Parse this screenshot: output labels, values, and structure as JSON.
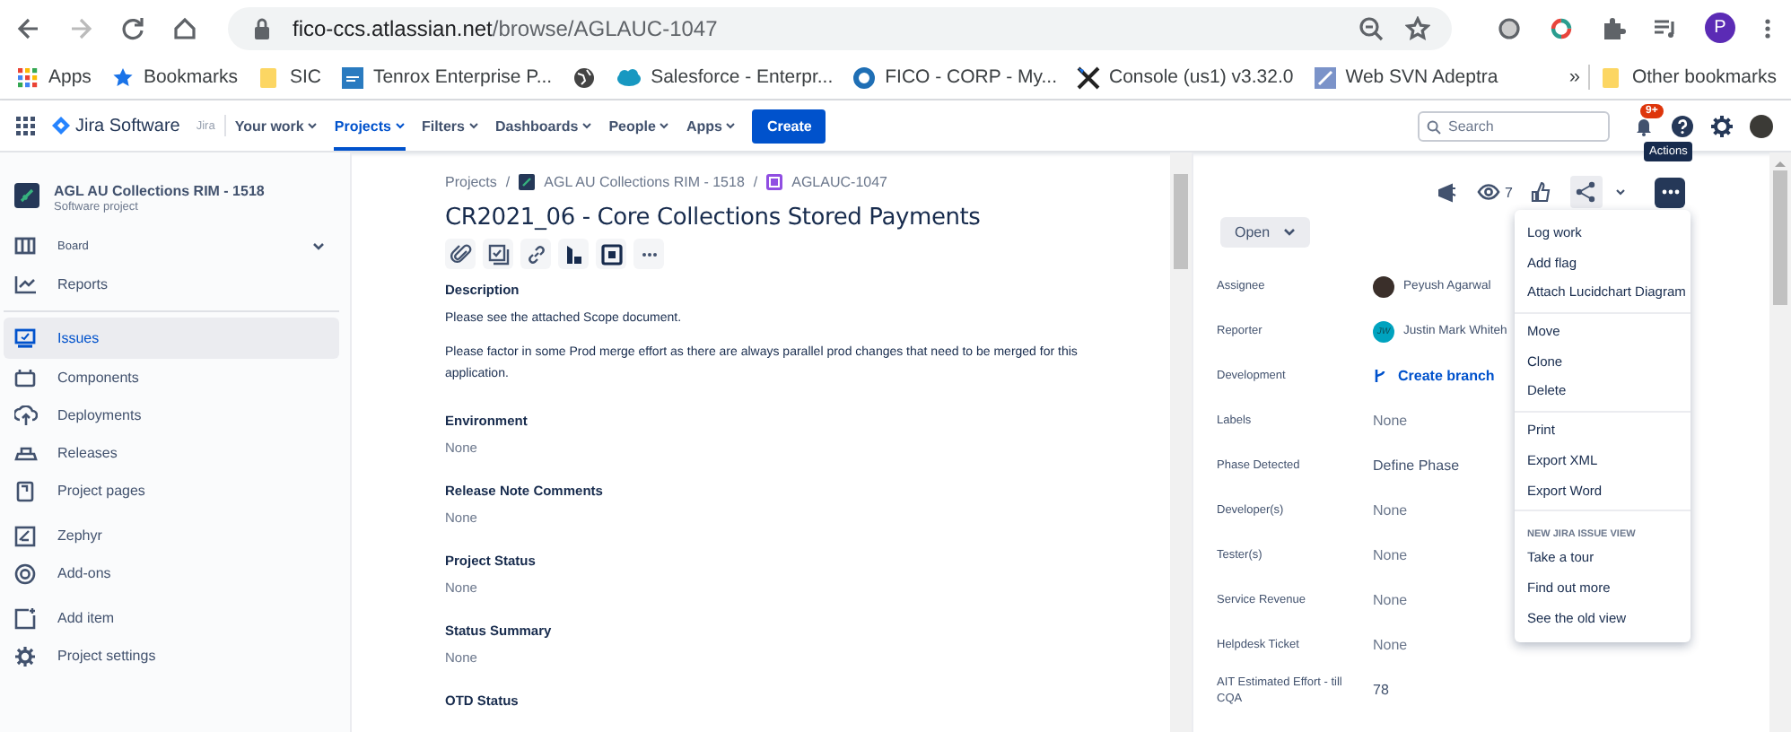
{
  "browser": {
    "url_host": "fico-ccs.atlassian.net",
    "url_path": "/browse/AGLAUC-1047",
    "profile_initial": "P"
  },
  "bookmarks": {
    "items": [
      {
        "label": "Apps",
        "kind": "apps"
      },
      {
        "label": "Bookmarks",
        "kind": "star"
      },
      {
        "label": "SIC",
        "kind": "folder"
      },
      {
        "label": "Tenrox Enterprise P...",
        "kind": "psa"
      },
      {
        "kind": "globe"
      },
      {
        "label": "Salesforce - Enterpr...",
        "kind": "cloud"
      },
      {
        "label": "FICO - CORP - My...",
        "kind": "ring"
      },
      {
        "label": "Console (us1) v3.32.0",
        "kind": "tools"
      },
      {
        "label": "Web SVN Adeptra",
        "kind": "svn"
      }
    ],
    "overflow": "»",
    "other": "Other bookmarks"
  },
  "nav": {
    "product": "Jira Software",
    "context": "Jira",
    "items": [
      {
        "label": "Your work",
        "selected": false
      },
      {
        "label": "Projects",
        "selected": true
      },
      {
        "label": "Filters",
        "selected": false
      },
      {
        "label": "Dashboards",
        "selected": false
      },
      {
        "label": "People",
        "selected": false
      },
      {
        "label": "Apps",
        "selected": false
      }
    ],
    "create": "Create",
    "search": {
      "placeholder": "Search"
    },
    "notification_badge": "9+"
  },
  "sidebar": {
    "project_name": "AGL AU Collections RIM - 1518",
    "project_type": "Software project",
    "items": [
      {
        "label": "Board",
        "kind": "board",
        "selected": false
      },
      {
        "label": "Reports",
        "kind": "reports",
        "selected": false
      },
      {
        "label": "Issues",
        "kind": "issues",
        "selected": true
      },
      {
        "label": "Components",
        "kind": "components",
        "selected": false
      },
      {
        "label": "Deployments",
        "kind": "deployments",
        "selected": false
      },
      {
        "label": "Releases",
        "kind": "releases",
        "selected": false
      },
      {
        "label": "Project pages",
        "kind": "pages",
        "selected": false
      },
      {
        "label": "Zephyr",
        "kind": "zephyr",
        "selected": false
      },
      {
        "label": "Add-ons",
        "kind": "addons",
        "selected": false
      },
      {
        "label": "Add item",
        "kind": "additem",
        "selected": false
      },
      {
        "label": "Project settings",
        "kind": "settings",
        "selected": false
      }
    ]
  },
  "issue": {
    "breadcrumb_separator": "/",
    "breadcrumbs": [
      "Projects",
      "AGL AU Collections RIM - 1518",
      "AGLAUC-1047"
    ],
    "title": "CR2021_06 - Core Collections Stored Payments",
    "description": {
      "heading": "Description",
      "paragraphs": [
        "Please see the attached Scope document.",
        "Please factor in some Prod merge effort as there are always parallel prod changes that need to be merged for this application."
      ]
    },
    "fields": [
      {
        "heading": "Environment",
        "value": "None"
      },
      {
        "heading": "Release Note Comments",
        "value": "None"
      },
      {
        "heading": "Project Status",
        "value": "None"
      },
      {
        "heading": "Status Summary",
        "value": "None"
      },
      {
        "heading": "OTD Status"
      }
    ]
  },
  "details": {
    "watch_count": "7",
    "tooltip": "Actions",
    "status": "Open",
    "fields": [
      {
        "label": "Assignee",
        "value": "Peyush Agarwal",
        "kind": "person"
      },
      {
        "label": "Reporter",
        "value": "Justin Mark Whiteh",
        "kind": "person",
        "initials": "JW"
      },
      {
        "label": "Development",
        "value": "Create branch",
        "kind": "link"
      },
      {
        "label": "Labels",
        "value": "None",
        "kind": "empty"
      },
      {
        "label": "Phase Detected",
        "value": "Define Phase",
        "kind": "text"
      },
      {
        "label": "Developer(s)",
        "value": "None",
        "kind": "empty"
      },
      {
        "label": "Tester(s)",
        "value": "None",
        "kind": "empty"
      },
      {
        "label": "Service Revenue",
        "value": "None",
        "kind": "empty"
      },
      {
        "label": "Helpdesk Ticket",
        "value": "None",
        "kind": "empty"
      },
      {
        "label": "AIT Estimated Effort - till CQA",
        "value": "78",
        "kind": "text"
      }
    ]
  },
  "actions_menu": [
    {
      "items": [
        "Log work",
        "Add flag",
        "Attach Lucidchart Diagram"
      ]
    },
    {
      "items": [
        "Move",
        "Clone",
        "Delete"
      ]
    },
    {
      "items": [
        "Print",
        "Export XML",
        "Export Word"
      ]
    },
    {
      "heading": "NEW JIRA ISSUE VIEW",
      "items": [
        "Take a tour",
        "Find out more",
        "See the old view"
      ]
    }
  ]
}
